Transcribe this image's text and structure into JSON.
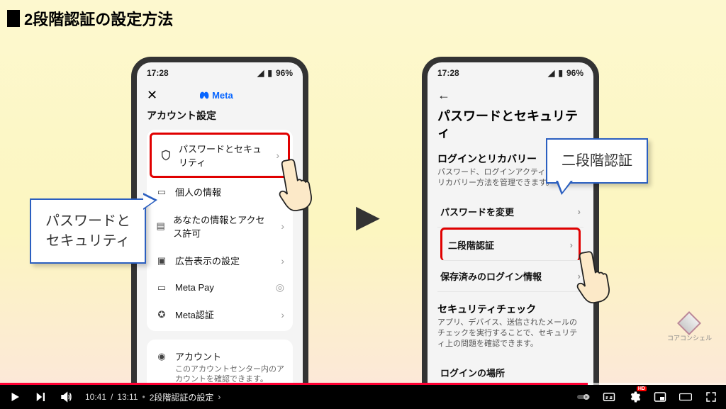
{
  "slide": {
    "title": "2段階認証の設定方法"
  },
  "statusbar": {
    "time": "17:28",
    "battery": "96%"
  },
  "phoneLeft": {
    "brand": "Meta",
    "header": "アカウント設定",
    "items": {
      "password": "パスワードとセキュリティ",
      "personal": "個人の情報",
      "yourinfo": "あなたの情報とアクセス許可",
      "adpref": "広告表示の設定",
      "metapay": "Meta Pay",
      "metaauth": "Meta認証"
    },
    "account": {
      "title": "アカウント",
      "desc": "このアカウントセンター内のアカウントを確認できます。"
    }
  },
  "phoneRight": {
    "heading": "パスワードとセキュリティ",
    "login": {
      "title": "ログインとリカバリー",
      "desc": "パスワード、ログインアクティビティ、リカバリー方法を管理できます。"
    },
    "rows": {
      "changepw": "パスワードを変更",
      "twofa": "二段階認証",
      "saved": "保存済みのログイン情報"
    },
    "seccheck": {
      "title": "セキュリティチェック",
      "desc": "アプリ、デバイス、送信されたメールのチェックを実行することで、セキュリティ上の問題を確認できます。"
    },
    "loginplace": "ログインの場所"
  },
  "callouts": {
    "left1": "パスワードと",
    "left2": "セキュリティ",
    "right": "二段階認証"
  },
  "brand": {
    "name": "コアコンシェル"
  },
  "player": {
    "current": "10:41",
    "duration": "13:11",
    "chapter": "2段階認証の設定",
    "hd": "HD"
  }
}
